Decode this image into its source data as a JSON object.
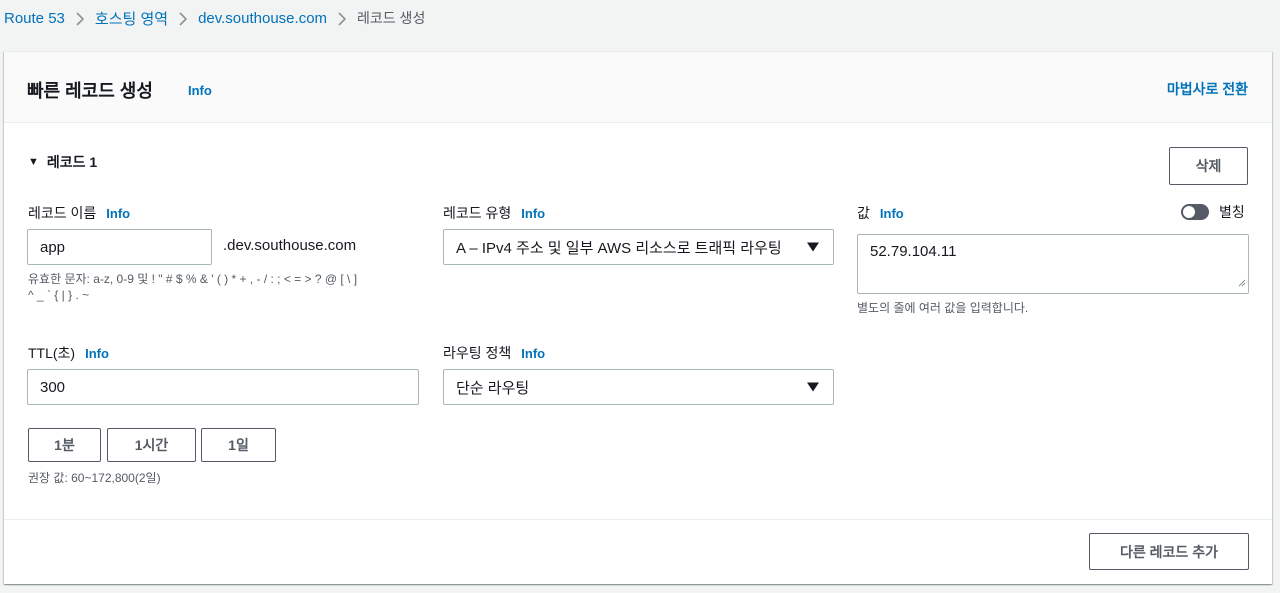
{
  "breadcrumb": {
    "items": [
      "Route 53",
      "호스팅 영역",
      "dev.southouse.com"
    ],
    "current": "레코드 생성"
  },
  "header": {
    "title": "빠른 레코드 생성",
    "info": "Info",
    "switch_label": "마법사로 전환"
  },
  "record": {
    "toggle_label": "레코드 1",
    "delete_label": "삭제",
    "name": {
      "label": "레코드 이름",
      "info": "Info",
      "value": "app",
      "suffix": ".dev.southouse.com",
      "hint_line1": "유효한 문자: a-z, 0-9 및 ! \" # $ % & ' ( ) * + , - / : ; < = > ? @ [ \\ ]",
      "hint_line2": "^ _ ` { | } . ~"
    },
    "type": {
      "label": "레코드 유형",
      "info": "Info",
      "value": "A – IPv4 주소 및 일부 AWS 리소스로 트래픽 라우팅"
    },
    "value": {
      "label": "값",
      "info": "Info",
      "text": "52.79.104.11",
      "hint": "별도의 줄에 여러 값을 입력합니다.",
      "alias_label": "별칭"
    },
    "ttl": {
      "label": "TTL(초)",
      "info": "Info",
      "value": "300",
      "presets": [
        "1분",
        "1시간",
        "1일"
      ],
      "hint": "권장 값: 60~172,800(2일)"
    },
    "routing": {
      "label": "라우팅 정책",
      "info": "Info",
      "value": "단순 라우팅"
    }
  },
  "footer": {
    "add_label": "다른 레코드 추가"
  }
}
